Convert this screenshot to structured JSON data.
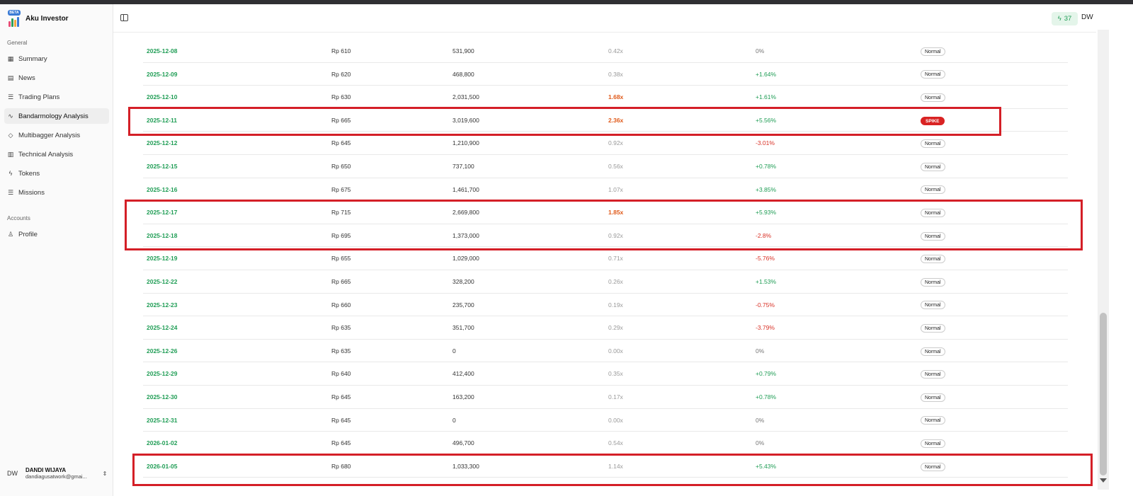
{
  "brand": {
    "badge": "BETA",
    "name": "Aku Investor"
  },
  "sidebar": {
    "general_label": "General",
    "items": [
      {
        "label": "Summary",
        "icon": "grid-icon"
      },
      {
        "label": "News",
        "icon": "newspaper-icon"
      },
      {
        "label": "Trading Plans",
        "icon": "list-icon"
      },
      {
        "label": "Bandarmology Analysis",
        "icon": "activity-icon",
        "active": true
      },
      {
        "label": "Multibagger Analysis",
        "icon": "diamond-icon"
      },
      {
        "label": "Technical Analysis",
        "icon": "bar-chart-icon"
      },
      {
        "label": "Tokens",
        "icon": "bolt-icon"
      },
      {
        "label": "Missions",
        "icon": "list-icon"
      }
    ],
    "accounts_label": "Accounts",
    "account_items": [
      {
        "label": "Profile",
        "icon": "user-icon"
      }
    ],
    "user": {
      "initials": "DW",
      "name": "DANDI WIJAYA",
      "email": "dandiagusatwork@gmai..."
    }
  },
  "header": {
    "tokens": "37",
    "initials": "DW"
  },
  "table": {
    "rows": [
      {
        "date": "2025-12-08",
        "price": "Rp 610",
        "volume": "531,900",
        "ratio": "0.42x",
        "ratio_hot": false,
        "change": "0%",
        "dir": "neu",
        "status": "Normal"
      },
      {
        "date": "2025-12-09",
        "price": "Rp 620",
        "volume": "468,800",
        "ratio": "0.38x",
        "ratio_hot": false,
        "change": "+1.64%",
        "dir": "pos",
        "status": "Normal"
      },
      {
        "date": "2025-12-10",
        "price": "Rp 630",
        "volume": "2,031,500",
        "ratio": "1.68x",
        "ratio_hot": true,
        "change": "+1.61%",
        "dir": "pos",
        "status": "Normal"
      },
      {
        "date": "2025-12-11",
        "price": "Rp 665",
        "volume": "3,019,600",
        "ratio": "2.36x",
        "ratio_hot": true,
        "change": "+5.56%",
        "dir": "pos",
        "status": "SPIKE"
      },
      {
        "date": "2025-12-12",
        "price": "Rp 645",
        "volume": "1,210,900",
        "ratio": "0.92x",
        "ratio_hot": false,
        "change": "-3.01%",
        "dir": "neg",
        "status": "Normal"
      },
      {
        "date": "2025-12-15",
        "price": "Rp 650",
        "volume": "737,100",
        "ratio": "0.56x",
        "ratio_hot": false,
        "change": "+0.78%",
        "dir": "pos",
        "status": "Normal"
      },
      {
        "date": "2025-12-16",
        "price": "Rp 675",
        "volume": "1,461,700",
        "ratio": "1.07x",
        "ratio_hot": false,
        "change": "+3.85%",
        "dir": "pos",
        "status": "Normal"
      },
      {
        "date": "2025-12-17",
        "price": "Rp 715",
        "volume": "2,669,800",
        "ratio": "1.85x",
        "ratio_hot": true,
        "change": "+5.93%",
        "dir": "pos",
        "status": "Normal"
      },
      {
        "date": "2025-12-18",
        "price": "Rp 695",
        "volume": "1,373,000",
        "ratio": "0.92x",
        "ratio_hot": false,
        "change": "-2.8%",
        "dir": "neg",
        "status": "Normal"
      },
      {
        "date": "2025-12-19",
        "price": "Rp 655",
        "volume": "1,029,000",
        "ratio": "0.71x",
        "ratio_hot": false,
        "change": "-5.76%",
        "dir": "neg",
        "status": "Normal"
      },
      {
        "date": "2025-12-22",
        "price": "Rp 665",
        "volume": "328,200",
        "ratio": "0.26x",
        "ratio_hot": false,
        "change": "+1.53%",
        "dir": "pos",
        "status": "Normal"
      },
      {
        "date": "2025-12-23",
        "price": "Rp 660",
        "volume": "235,700",
        "ratio": "0.19x",
        "ratio_hot": false,
        "change": "-0.75%",
        "dir": "neg",
        "status": "Normal"
      },
      {
        "date": "2025-12-24",
        "price": "Rp 635",
        "volume": "351,700",
        "ratio": "0.29x",
        "ratio_hot": false,
        "change": "-3.79%",
        "dir": "neg",
        "status": "Normal"
      },
      {
        "date": "2025-12-26",
        "price": "Rp 635",
        "volume": "0",
        "ratio": "0.00x",
        "ratio_hot": false,
        "change": "0%",
        "dir": "neu",
        "status": "Normal"
      },
      {
        "date": "2025-12-29",
        "price": "Rp 640",
        "volume": "412,400",
        "ratio": "0.35x",
        "ratio_hot": false,
        "change": "+0.79%",
        "dir": "pos",
        "status": "Normal"
      },
      {
        "date": "2025-12-30",
        "price": "Rp 645",
        "volume": "163,200",
        "ratio": "0.17x",
        "ratio_hot": false,
        "change": "+0.78%",
        "dir": "pos",
        "status": "Normal"
      },
      {
        "date": "2025-12-31",
        "price": "Rp 645",
        "volume": "0",
        "ratio": "0.00x",
        "ratio_hot": false,
        "change": "0%",
        "dir": "neu",
        "status": "Normal"
      },
      {
        "date": "2026-01-02",
        "price": "Rp 645",
        "volume": "496,700",
        "ratio": "0.54x",
        "ratio_hot": false,
        "change": "0%",
        "dir": "neu",
        "status": "Normal"
      },
      {
        "date": "2026-01-05",
        "price": "Rp 680",
        "volume": "1,033,300",
        "ratio": "1.14x",
        "ratio_hot": false,
        "change": "+5.43%",
        "dir": "pos",
        "status": "Normal"
      }
    ]
  },
  "colors": {
    "accent_green": "#1f9d55",
    "negative_red": "#d93025",
    "hot_orange": "#e05a1a",
    "highlight_red": "#d41f27",
    "spike_red": "#d92323"
  }
}
